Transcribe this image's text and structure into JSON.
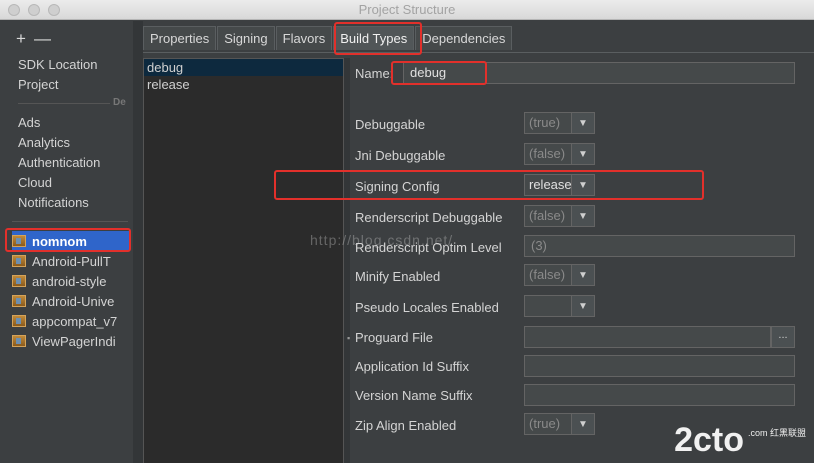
{
  "window": {
    "title": "Project Structure"
  },
  "sidebar": {
    "add_label": "+",
    "remove_label": "—",
    "top_items": [
      "SDK Location",
      "Project"
    ],
    "section_label": "De",
    "dev_items": [
      "Ads",
      "Analytics",
      "Authentication",
      "Cloud",
      "Notifications"
    ],
    "modules": [
      "nomnom",
      "Android-PullT",
      "android-style",
      "Android-Unive",
      "appcompat_v7",
      "ViewPagerIndi"
    ]
  },
  "tabs": [
    "Properties",
    "Signing",
    "Flavors",
    "Build Types",
    "Dependencies"
  ],
  "active_tab": "Build Types",
  "build_types": [
    "debug",
    "release"
  ],
  "form": {
    "name_label": "Name:",
    "name_value": "debug",
    "rows": {
      "debuggable": {
        "label": "Debuggable",
        "value": "(true)"
      },
      "jni_debuggable": {
        "label": "Jni Debuggable",
        "value": "(false)"
      },
      "signing_config": {
        "label": "Signing Config",
        "value": "release"
      },
      "renderscript_debuggable": {
        "label": "Renderscript Debuggable",
        "value": "(false)"
      },
      "renderscript_optim_level": {
        "label": "Renderscript Optim Level",
        "value": "(3)"
      },
      "minify_enabled": {
        "label": "Minify Enabled",
        "value": "(false)"
      },
      "pseudo_locales_enabled": {
        "label": "Pseudo Locales Enabled",
        "value": ""
      },
      "proguard_file": {
        "label": "Proguard File",
        "value": "",
        "browse": "..."
      },
      "application_id_suffix": {
        "label": "Application Id Suffix",
        "value": ""
      },
      "version_name_suffix": {
        "label": "Version Name Suffix",
        "value": ""
      },
      "zip_align_enabled": {
        "label": "Zip Align Enabled",
        "value": "(true)"
      }
    }
  },
  "overlay": {
    "watermark": "http://blog.csdn.net/",
    "logo_main": "2cto",
    "logo_sub": ".com 红黑联盟"
  },
  "colors": {
    "highlight": "#e2302b",
    "selection": "#2f65ca",
    "background": "#3c3f41"
  }
}
